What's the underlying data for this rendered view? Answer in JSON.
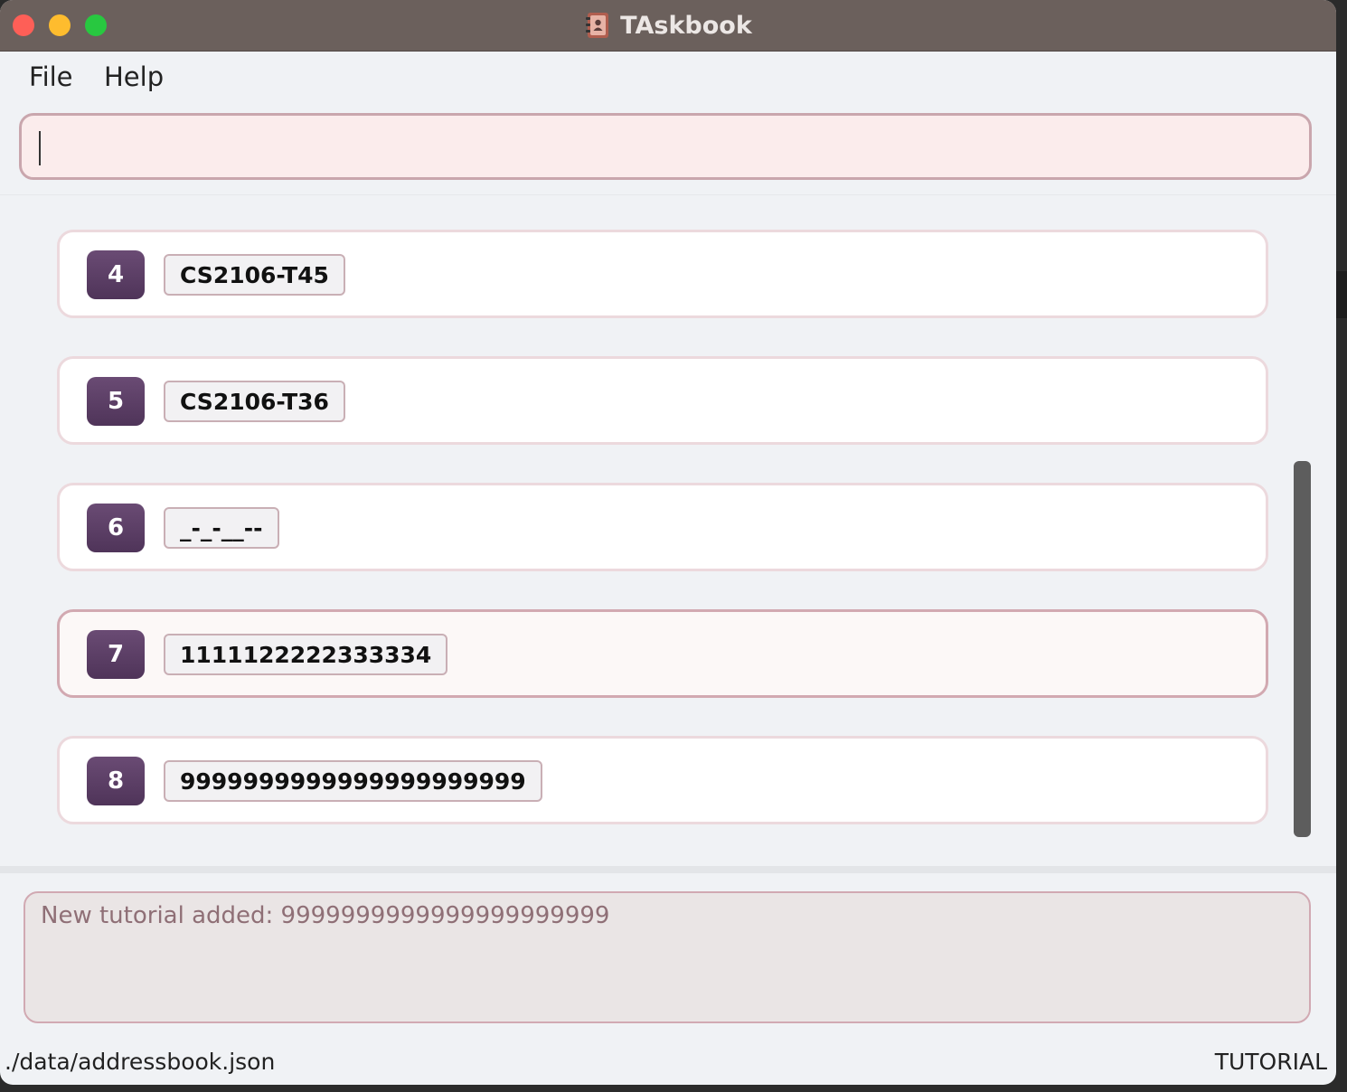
{
  "window": {
    "title": "TAskbook",
    "app_icon": "address-book-icon"
  },
  "menu": {
    "file_label": "File",
    "help_label": "Help"
  },
  "command_box": {
    "value": "",
    "placeholder": ""
  },
  "list": {
    "items": [
      {
        "index": "4",
        "tag": "CS2106-T45"
      },
      {
        "index": "5",
        "tag": "CS2106-T36"
      },
      {
        "index": "6",
        "tag": "_-_-__--"
      },
      {
        "index": "7",
        "tag": "1111122222333334",
        "selected": true
      },
      {
        "index": "8",
        "tag": "9999999999999999999999"
      }
    ]
  },
  "result": {
    "text": "New tutorial added: 9999999999999999999999"
  },
  "status_bar": {
    "path": "./data/addressbook.json",
    "mode": "TUTORIAL"
  },
  "colors": {
    "titlebar": "#6b605c",
    "badge": "#5b3f66",
    "command_bg": "#fbecec",
    "result_bg": "#eae5e5"
  }
}
